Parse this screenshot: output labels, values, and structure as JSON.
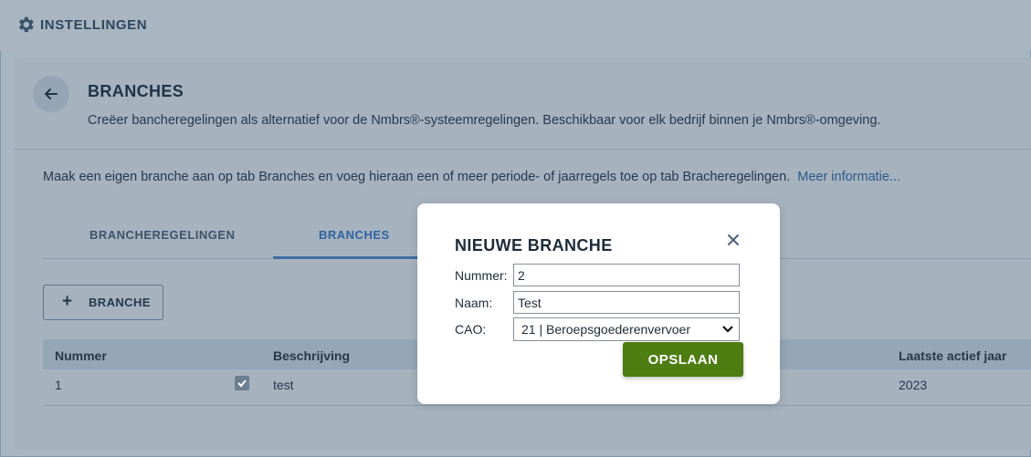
{
  "header": {
    "title": "INSTELLINGEN",
    "icon": "gear-icon"
  },
  "page": {
    "title": "BRANCHES",
    "subtitle": "Creëer bancheregelingen als alternatief voor de Nmbrs®-systeemregelingen. Beschikbaar voor elk bedrijf binnen je Nmbrs®-omgeving.",
    "info_text": "Maak een eigen branche aan op tab Branches en voeg hieraan een of meer periode- of jaarregels toe op tab Bracheregelingen.",
    "info_link": "Meer informatie..."
  },
  "tabs": [
    {
      "label": "BRANCHEREGELINGEN",
      "active": false
    },
    {
      "label": "BRANCHES",
      "active": true
    }
  ],
  "add_button": {
    "label": "BRANCHE",
    "icon": "plus-icon"
  },
  "table": {
    "headers": {
      "nummer": "Nummer",
      "beschrijving": "Beschrijving",
      "laatste_jaar": "Laatste actief jaar"
    },
    "rows": [
      {
        "nummer": "1",
        "checked": true,
        "beschrijving": "test",
        "laatste_jaar": "2023"
      }
    ]
  },
  "modal": {
    "title": "NIEUWE BRANCHE",
    "fields": {
      "nummer": {
        "label": "Nummer:",
        "value": "2"
      },
      "naam": {
        "label": "Naam:",
        "value": "Test"
      },
      "cao": {
        "label": "CAO:",
        "value": "21 | Beroepsgoederenvervoer"
      }
    },
    "save_label": "OPSLAAN"
  },
  "colors": {
    "accent": "#2f63a0",
    "save": "#4e7d12",
    "overlay": "#a8b6c2"
  }
}
